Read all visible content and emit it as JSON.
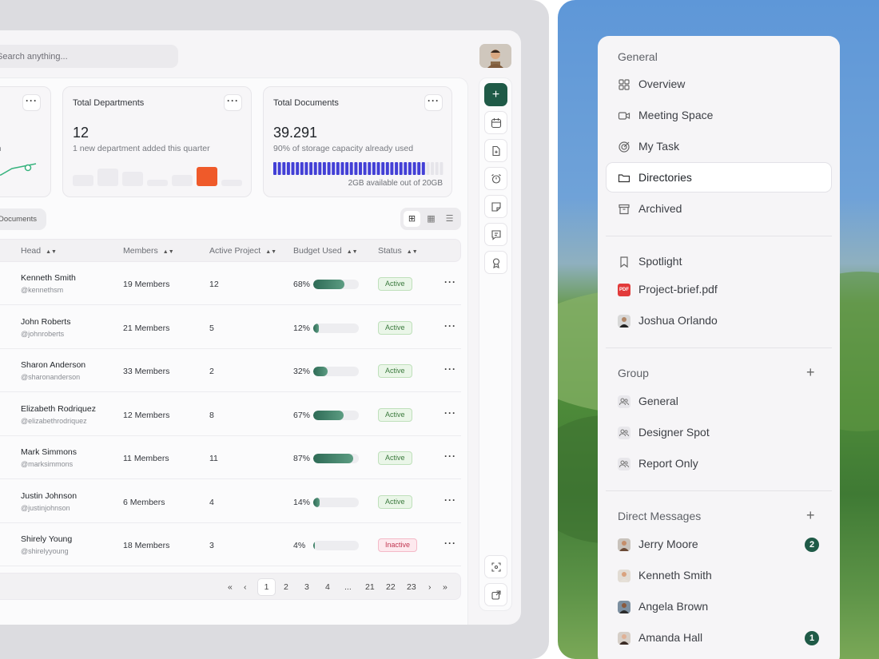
{
  "search": {
    "placeholder": "Search anything..."
  },
  "stats": {
    "partial_sub": "onth",
    "departments": {
      "title": "Total Departments",
      "value": "12",
      "sub": "1 new department added this quarter"
    },
    "documents": {
      "title": "Total Documents",
      "value": "39.291",
      "sub": "90% of storage capacity already used",
      "storage_note": "2GB available out of 20GB",
      "storage_fill": 0.9
    }
  },
  "segment": {
    "label": "Documents"
  },
  "table": {
    "headers": {
      "head": "Head",
      "members": "Members",
      "active_project": "Active Project",
      "budget_used": "Budget Used",
      "status": "Status"
    },
    "rows": [
      {
        "name": "Kenneth Smith",
        "handle": "@kennethsm",
        "members": "19 Members",
        "projects": "12",
        "budget": "68%",
        "budget_value": 68,
        "status": "Active"
      },
      {
        "name": "John Roberts",
        "handle": "@johnroberts",
        "members": "21 Members",
        "projects": "5",
        "budget": "12%",
        "budget_value": 12,
        "status": "Active"
      },
      {
        "name": "Sharon Anderson",
        "handle": "@sharonanderson",
        "members": "33 Members",
        "projects": "2",
        "budget": "32%",
        "budget_value": 32,
        "status": "Active"
      },
      {
        "name": "Elizabeth Rodriquez",
        "handle": "@elizabethrodriquez",
        "members": "12 Members",
        "projects": "8",
        "budget": "67%",
        "budget_value": 67,
        "status": "Active"
      },
      {
        "name": "Mark Simmons",
        "handle": "@marksimmons",
        "members": "11 Members",
        "projects": "11",
        "budget": "87%",
        "budget_value": 87,
        "status": "Active"
      },
      {
        "name": "Justin Johnson",
        "handle": "@justinjohnson",
        "members": "6 Members",
        "projects": "4",
        "budget": "14%",
        "budget_value": 14,
        "status": "Active"
      },
      {
        "name": "Shirely Young",
        "handle": "@shirelyyoung",
        "members": "18 Members",
        "projects": "3",
        "budget": "4%",
        "budget_value": 4,
        "status": "Inactive"
      }
    ]
  },
  "pagination": {
    "first": "«",
    "prev": "‹",
    "pages": [
      "1",
      "2",
      "3",
      "4",
      "...",
      "21",
      "22",
      "23"
    ],
    "next": "›",
    "last": "»",
    "current": "1"
  },
  "sidebar": {
    "general_title": "General",
    "general": [
      {
        "label": "Overview",
        "icon": "grid-icon"
      },
      {
        "label": "Meeting Space",
        "icon": "video-icon"
      },
      {
        "label": "My Task",
        "icon": "target-icon"
      },
      {
        "label": "Directories",
        "icon": "folder-icon",
        "selected": true
      },
      {
        "label": "Archived",
        "icon": "archive-icon"
      }
    ],
    "pinned": [
      {
        "label": "Spotlight",
        "icon": "bookmark-icon"
      },
      {
        "label": "Project-brief.pdf",
        "icon": "pdf-icon",
        "icon_text": "PDF"
      },
      {
        "label": "Joshua Orlando",
        "icon": "avatar"
      }
    ],
    "group_title": "Group",
    "groups": [
      {
        "label": "General"
      },
      {
        "label": "Designer Spot"
      },
      {
        "label": "Report Only"
      }
    ],
    "dm_title": "Direct Messages",
    "dms": [
      {
        "label": "Jerry Moore",
        "count": "2"
      },
      {
        "label": "Kenneth Smith",
        "count": ""
      },
      {
        "label": "Angela Brown",
        "count": ""
      },
      {
        "label": "Amanda Hall",
        "count": "1"
      }
    ]
  },
  "colors": {
    "accent": "#1f5a47",
    "bar_gauge": "#4340d6",
    "trend": "#37b37e",
    "highlight_bar": "#ef5a2a"
  }
}
